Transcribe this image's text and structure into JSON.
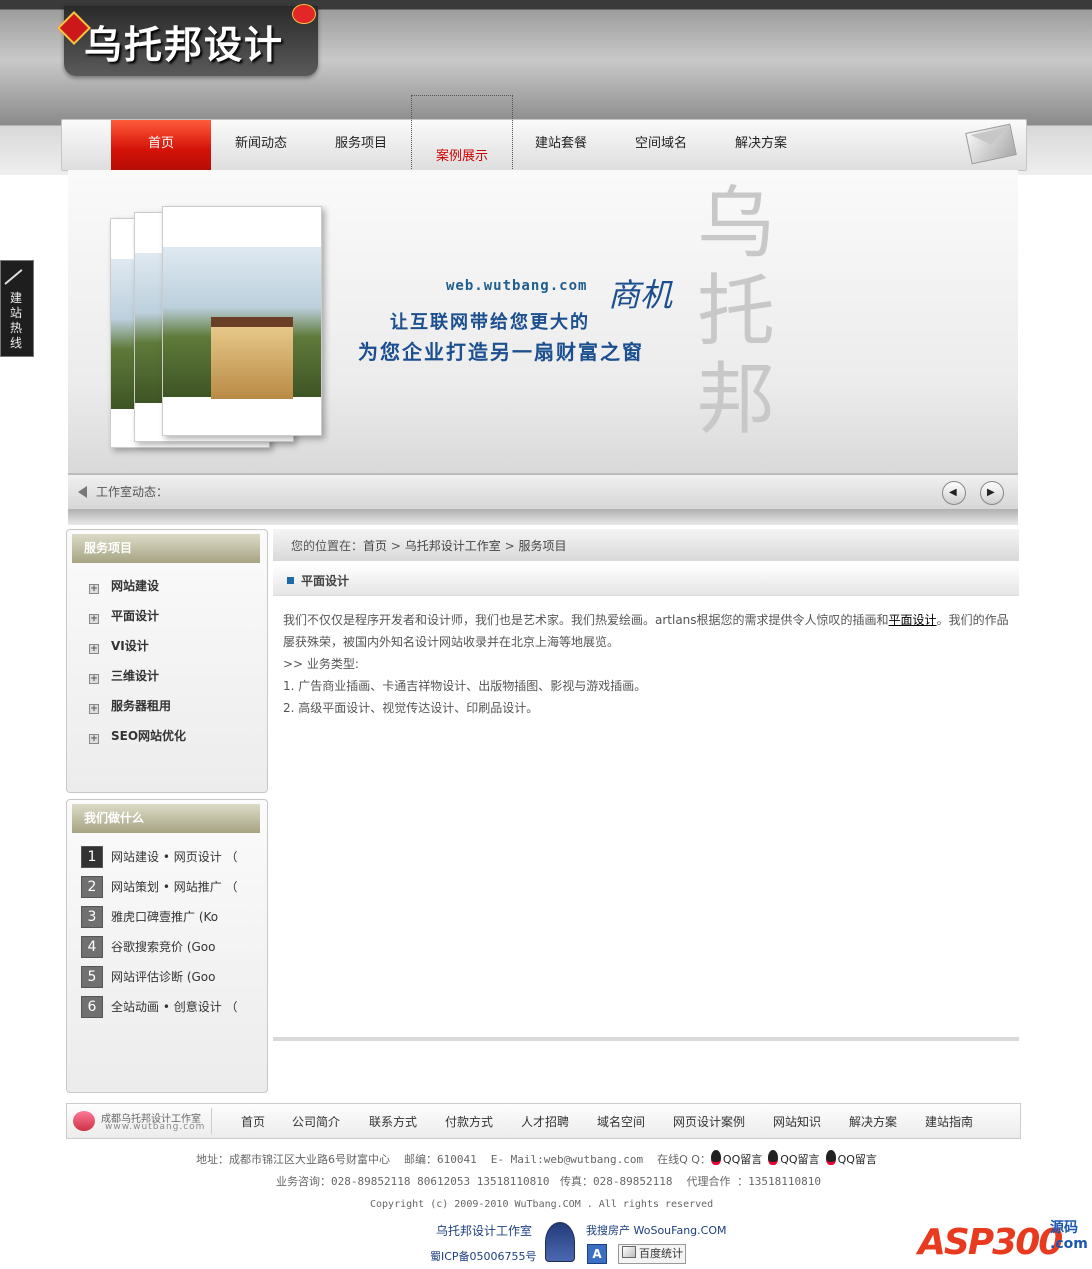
{
  "header": {
    "logo_text": "乌托邦设计",
    "nav": [
      "首页",
      "新闻动态",
      "服务项目",
      "案例展示",
      "建站套餐",
      "空间域名",
      "解决方案"
    ]
  },
  "side_tab": {
    "label": "建站热线"
  },
  "banner": {
    "url": "web.wutbang.com",
    "line1": "让互联网带给您更大的",
    "line2": "为您企业打造另一扇财富之窗",
    "highlight": "商机",
    "calligraphy": "乌托邦"
  },
  "newsbar": {
    "label": "工作室动态：",
    "prev": "◀",
    "next": "▶"
  },
  "services": {
    "title": "服务项目",
    "items": [
      "网站建设",
      "平面设计",
      "VI设计",
      "三维设计",
      "服务器租用",
      "SEO网站优化"
    ]
  },
  "whatwedo": {
    "title": "我们做什么",
    "items": [
      {
        "num": "1",
        "text": "网站建设 • 网页设计 （"
      },
      {
        "num": "2",
        "text": "网站策划 • 网站推广 （"
      },
      {
        "num": "3",
        "text": "雅虎口碑壹推广 (Ko"
      },
      {
        "num": "4",
        "text": "谷歌搜索竞价 (Goo"
      },
      {
        "num": "5",
        "text": "网站评估诊断 (Goo"
      },
      {
        "num": "6",
        "text": "全站动画 • 创意设计 （"
      }
    ]
  },
  "breadcrumb": {
    "prefix": "您的位置在：",
    "items": [
      "首页",
      "乌托邦设计工作室",
      "服务项目"
    ],
    "sep": ">"
  },
  "content": {
    "title": "平面设计",
    "p1_before": "我们不仅仅是程序开发者和设计师，我们也是艺术家。我们热爱绘画。artlans根据您的需求提供令人惊叹的插画和",
    "p1_link": "平面设计",
    "p1_after": "。我们的作品屡获殊荣，被国内外知名设计网站收录并在北京上海等地展览。",
    "p2": ">> 业务类型:",
    "p3": "1. 广告商业插画、卡通吉祥物设计、出版物插图、影视与游戏插画。",
    "p4": "2. 高级平面设计、视觉传达设计、印刷品设计。"
  },
  "footer": {
    "logo_line1": "成都乌托邦设计工作室",
    "logo_line2": "www.wutbang.com",
    "nav": [
      "首页",
      "公司简介",
      "联系方式",
      "付款方式",
      "人才招聘",
      "域名空间",
      "网页设计案例",
      "网站知识",
      "解决方案",
      "建站指南"
    ],
    "address": "地址：成都市锦江区大业路6号财富中心",
    "postcode": "邮编：610041",
    "email": "E- Mail:web@wutbang.com",
    "qq_label": "在线Q Q：",
    "qq_items": [
      "QQ留言",
      "QQ留言",
      "QQ留言"
    ],
    "phone": "业务咨询：028-89852118 80612053  13518110810",
    "fax": "传真：028-89852118",
    "agent": "代理合作 ：13518110810",
    "copyright": "Copyright (c) 2009-2010 WuTbang.COM . All rights reserved",
    "studio": "乌托邦设计工作室",
    "partner": "我搜房产 WoSouFang.COM",
    "icp": "蜀ICP备05006755号",
    "a_icon": "A",
    "tongji": "百度统计"
  },
  "watermark": {
    "text": "ASP300",
    "sub1": "源码",
    "sub2": ".com"
  }
}
